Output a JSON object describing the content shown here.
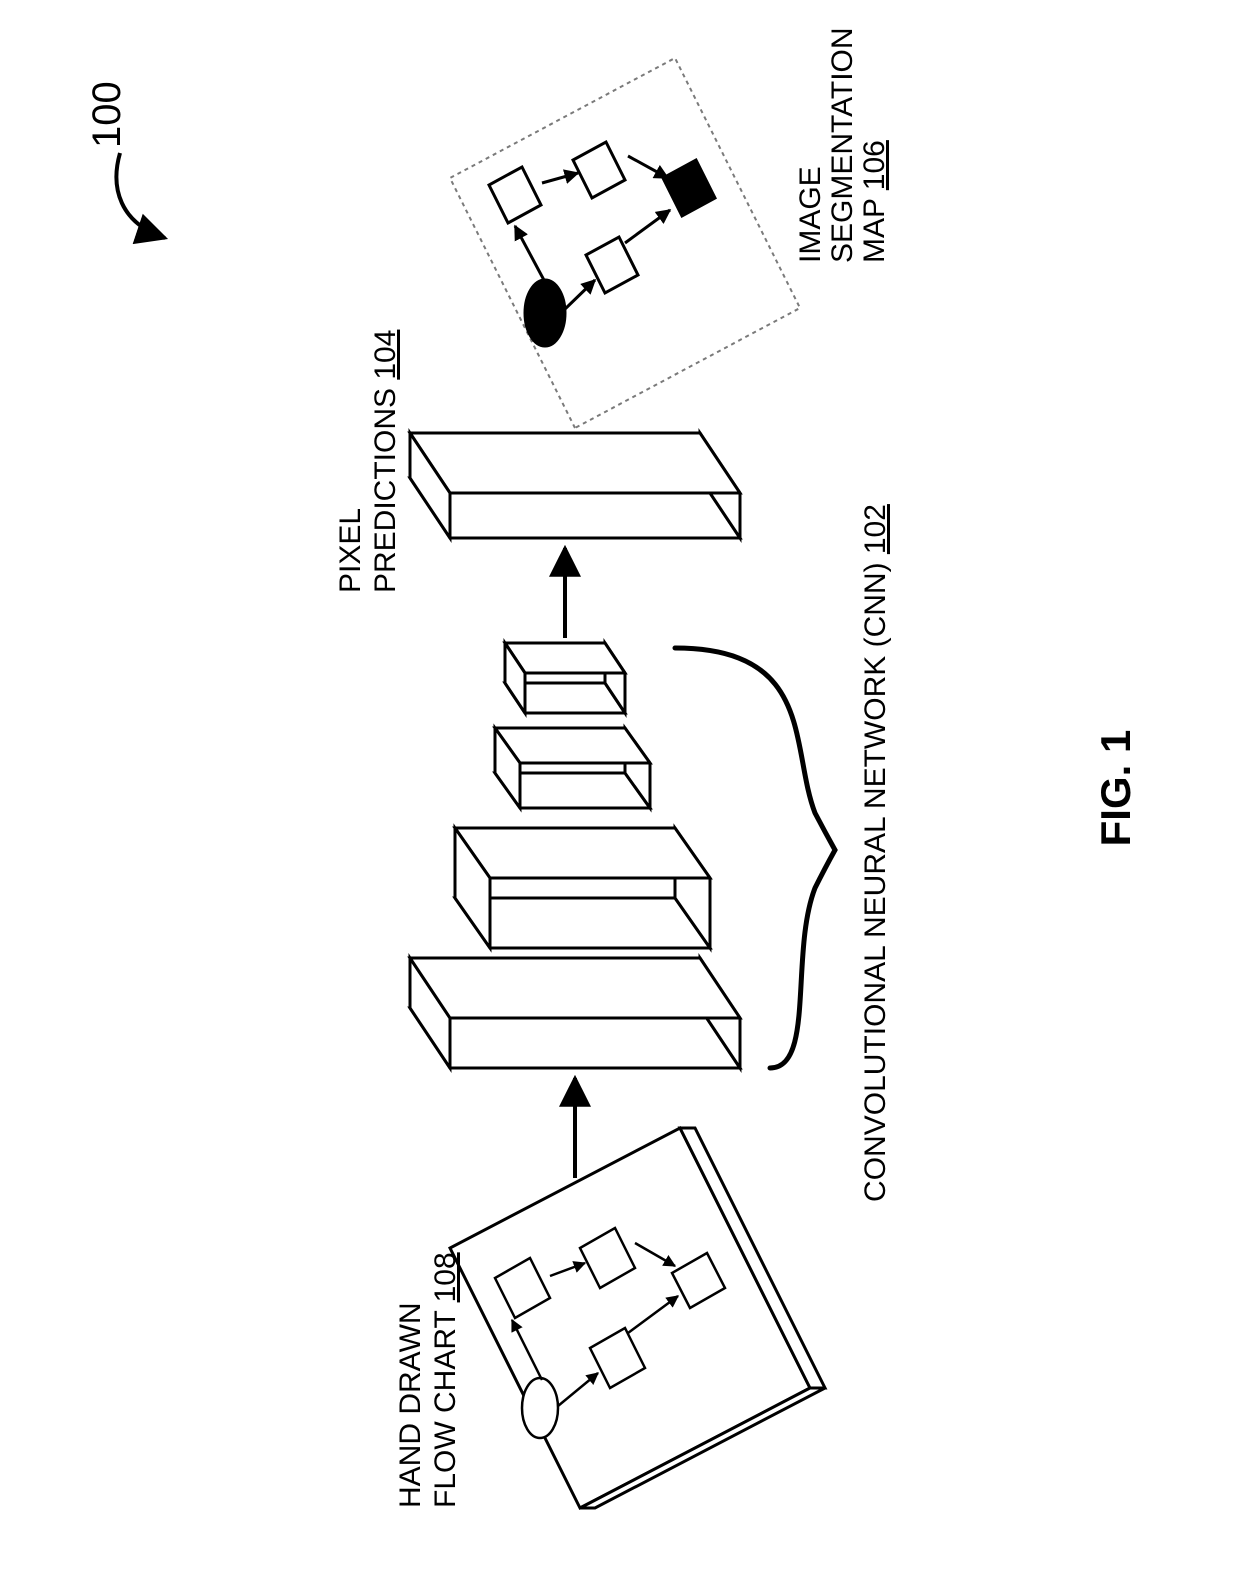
{
  "figure": {
    "number": "100",
    "caption": "FIG. 1",
    "labels": {
      "input": {
        "line1": "HAND DRAWN",
        "line2_pre": "FLOW CHART ",
        "ref": "108"
      },
      "cnn": {
        "pre": "CONVOLUTIONAL NEURAL NETWORK (CNN) ",
        "ref": "102"
      },
      "pixel": {
        "line1": "PIXEL",
        "line2_pre": "PREDICTIONS ",
        "ref": "104"
      },
      "segmap": {
        "line1": "IMAGE",
        "line2": "SEGMENTATION",
        "line3_pre": "MAP ",
        "ref": "106"
      }
    }
  }
}
